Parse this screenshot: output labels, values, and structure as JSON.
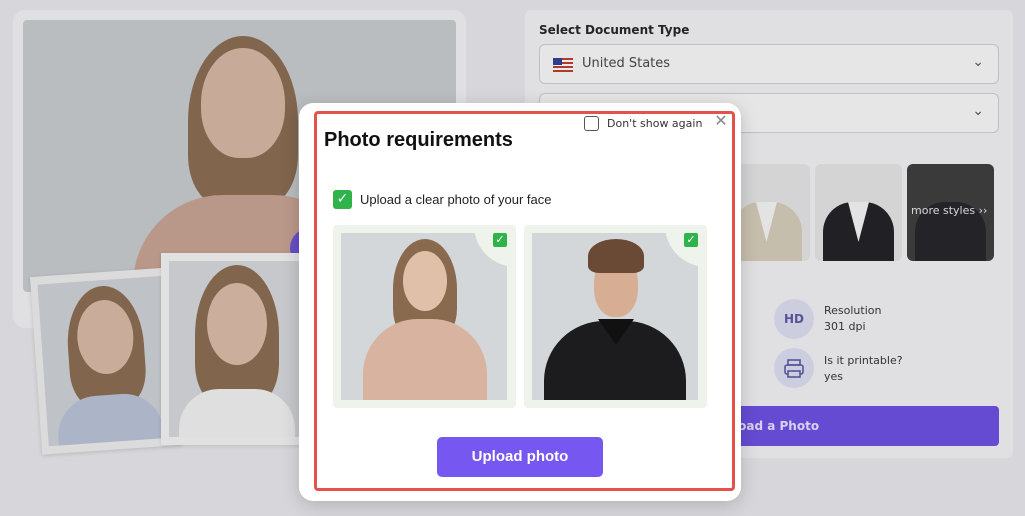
{
  "background": {
    "document_type_label": "Select Document Type",
    "country_select_value": "United States",
    "more_styles_label": "more styles ››",
    "info": [
      {
        "icon": "HD",
        "title": "Resolution",
        "value": "301 dpi"
      },
      {
        "icon": "printer",
        "title": "Is it printable?",
        "value": "yes"
      }
    ],
    "upload_button_label": "load a Photo"
  },
  "modal": {
    "dont_show_label": "Don't show again",
    "close_symbol": "✕",
    "title": "Photo requirements",
    "requirement_text": "Upload a clear photo of your face",
    "check_symbol": "✓",
    "upload_button_label": "Upload photo"
  },
  "colors": {
    "accent": "#7658f0",
    "highlight": "#e3534c",
    "check_green": "#2fb34a"
  }
}
